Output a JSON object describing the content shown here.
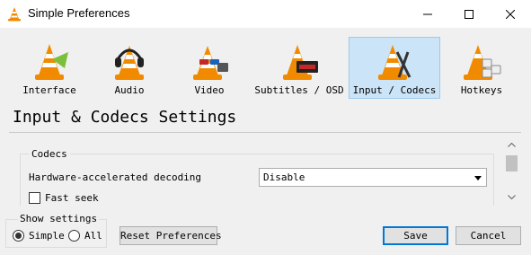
{
  "window": {
    "title": "Simple Preferences"
  },
  "toolbar": {
    "items": [
      {
        "label": "Interface",
        "icon": "vlc-cone-interface-icon"
      },
      {
        "label": "Audio",
        "icon": "vlc-cone-headphones-icon"
      },
      {
        "label": "Video",
        "icon": "vlc-cone-glasses-icon"
      },
      {
        "label": "Subtitles / OSD",
        "icon": "vlc-cone-subtitles-icon"
      },
      {
        "label": "Input / Codecs",
        "icon": "vlc-cone-codecs-icon",
        "selected": true
      },
      {
        "label": "Hotkeys",
        "icon": "vlc-cone-hotkeys-icon"
      }
    ]
  },
  "page": {
    "title": "Input & Codecs Settings"
  },
  "codecs": {
    "group_title": "Codecs",
    "hw_label": "Hardware-accelerated decoding",
    "hw_value": "Disable",
    "fast_seek_label": "Fast seek",
    "fast_seek_checked": false
  },
  "show_settings": {
    "title": "Show settings",
    "simple_label": "Simple",
    "all_label": "All",
    "selected": "Simple"
  },
  "buttons": {
    "reset": "Reset Preferences",
    "save": "Save",
    "cancel": "Cancel"
  },
  "colors": {
    "cone_orange": "#f28a00",
    "cone_white": "#ffffff",
    "selected_bg": "#cce4f7",
    "selected_border": "#99c9ef",
    "default_button_border": "#0078d7"
  }
}
